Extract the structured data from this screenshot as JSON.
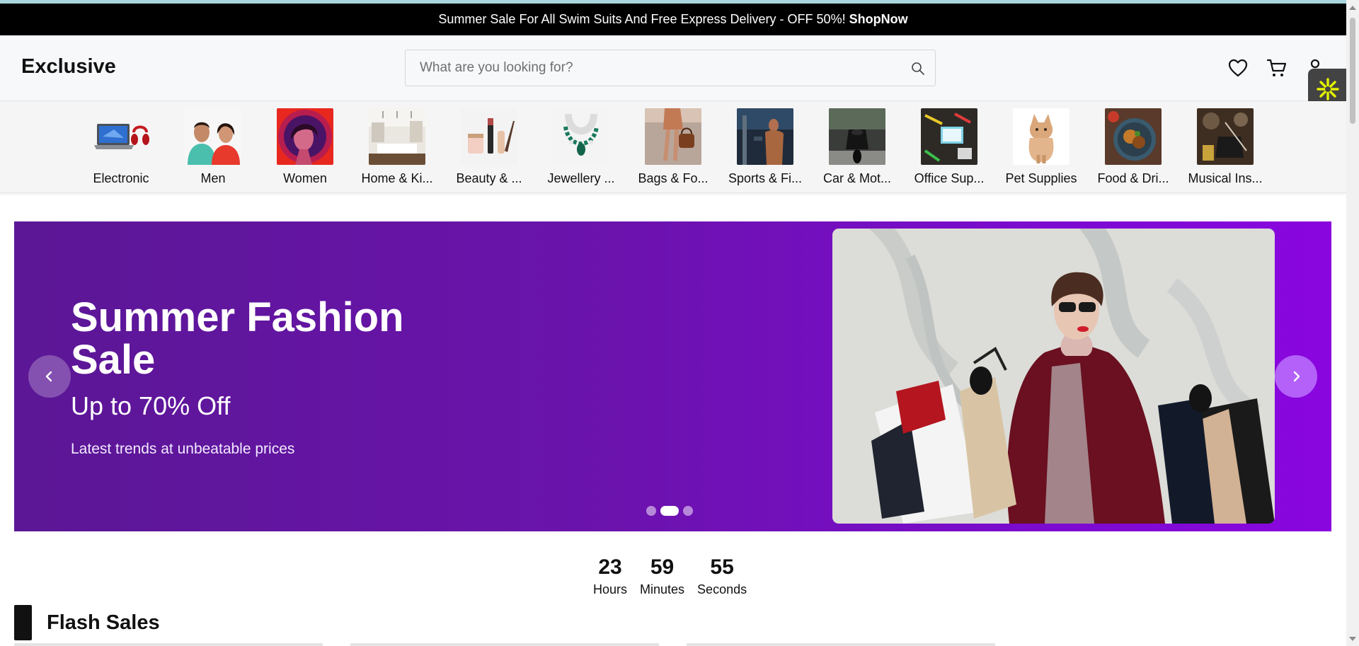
{
  "announcement": {
    "text": "Summer Sale For All Swim Suits And Free Express Delivery - OFF 50%!",
    "link": "ShopNow"
  },
  "header": {
    "logo": "Exclusive",
    "search_placeholder": "What are you looking for?",
    "icons": [
      "search-icon",
      "heart-icon",
      "cart-icon",
      "user-icon"
    ]
  },
  "categories": [
    {
      "label": "Electronic"
    },
    {
      "label": "Men"
    },
    {
      "label": "Women"
    },
    {
      "label": "Home & Ki..."
    },
    {
      "label": "Beauty & ..."
    },
    {
      "label": "Jewellery ..."
    },
    {
      "label": "Bags & Fo..."
    },
    {
      "label": "Sports & Fi..."
    },
    {
      "label": "Car & Mot..."
    },
    {
      "label": "Office Sup..."
    },
    {
      "label": "Pet Supplies"
    },
    {
      "label": "Food & Dri..."
    },
    {
      "label": "Musical Ins..."
    }
  ],
  "hero": {
    "title": "Summer Fashion Sale",
    "subtitle": "Up to 70% Off",
    "description": "Latest trends at unbeatable prices",
    "slide_count": 3,
    "active_slide": 2,
    "colors": {
      "start": "#5b1795",
      "end": "#8a06df"
    }
  },
  "countdown": [
    {
      "value": "23",
      "label": "Hours"
    },
    {
      "value": "59",
      "label": "Minutes"
    },
    {
      "value": "55",
      "label": "Seconds"
    }
  ],
  "flash_sales": {
    "title": "Flash Sales"
  }
}
